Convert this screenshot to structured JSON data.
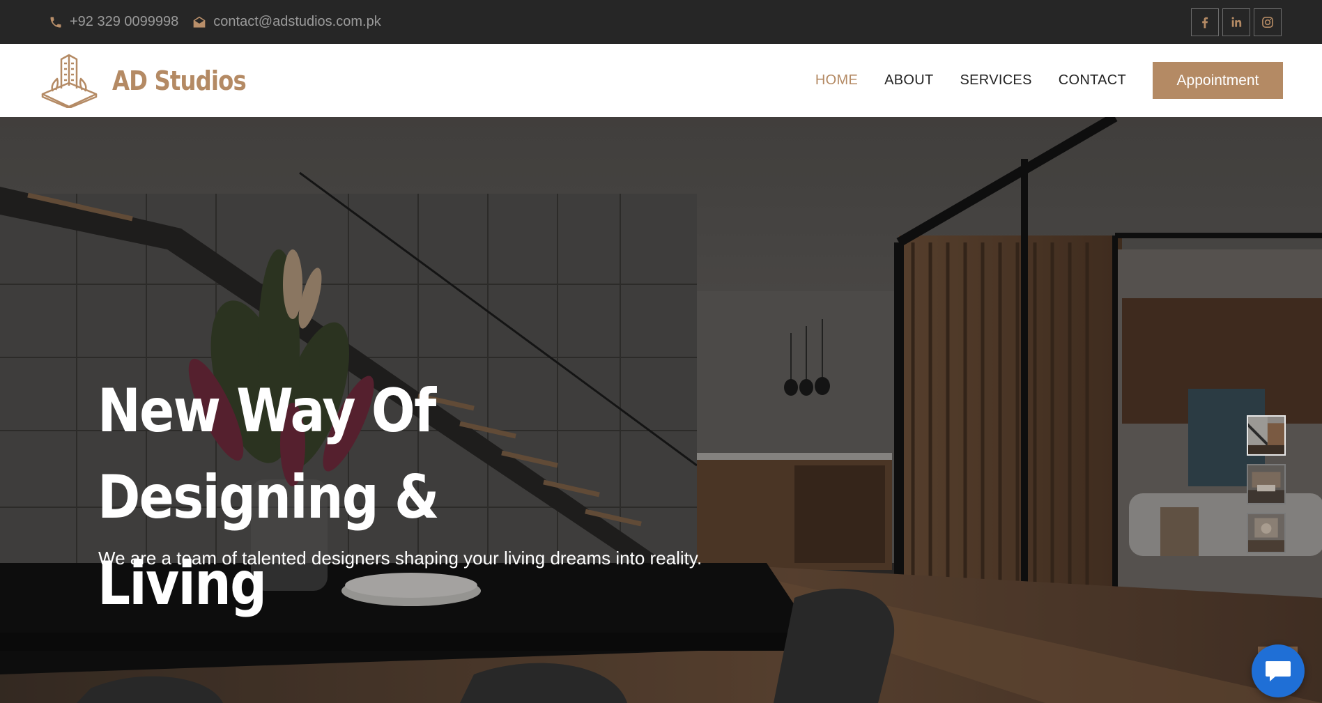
{
  "topbar": {
    "phone": "+92 329 0099998",
    "email": "contact@adstudios.com.pk",
    "phone_icon": "phone-icon",
    "email_icon": "envelope-open-icon",
    "socials": [
      {
        "name": "facebook",
        "icon": "facebook-icon"
      },
      {
        "name": "linkedin",
        "icon": "linkedin-icon"
      },
      {
        "name": "instagram",
        "icon": "instagram-icon"
      }
    ]
  },
  "brand": {
    "name": "AD Studios",
    "logo_icon": "building-logo-icon",
    "color": "#b48a64"
  },
  "nav": {
    "items": [
      {
        "label": "HOME",
        "active": true
      },
      {
        "label": "ABOUT",
        "active": false
      },
      {
        "label": "SERVICES",
        "active": false
      },
      {
        "label": "CONTACT",
        "active": false
      }
    ],
    "cta": "Appointment"
  },
  "hero": {
    "title_line1": "New Way Of Designing &",
    "title_line2": "Living",
    "subtitle": "We are a team of talented designers shaping your living dreams into reality.",
    "slides_count": 3,
    "active_slide": 1
  },
  "widgets": {
    "chat_icon": "chat-bubble-icon"
  },
  "colors": {
    "accent": "#b48a64",
    "topbar_bg": "#262626",
    "chat": "#1f6fd6"
  }
}
